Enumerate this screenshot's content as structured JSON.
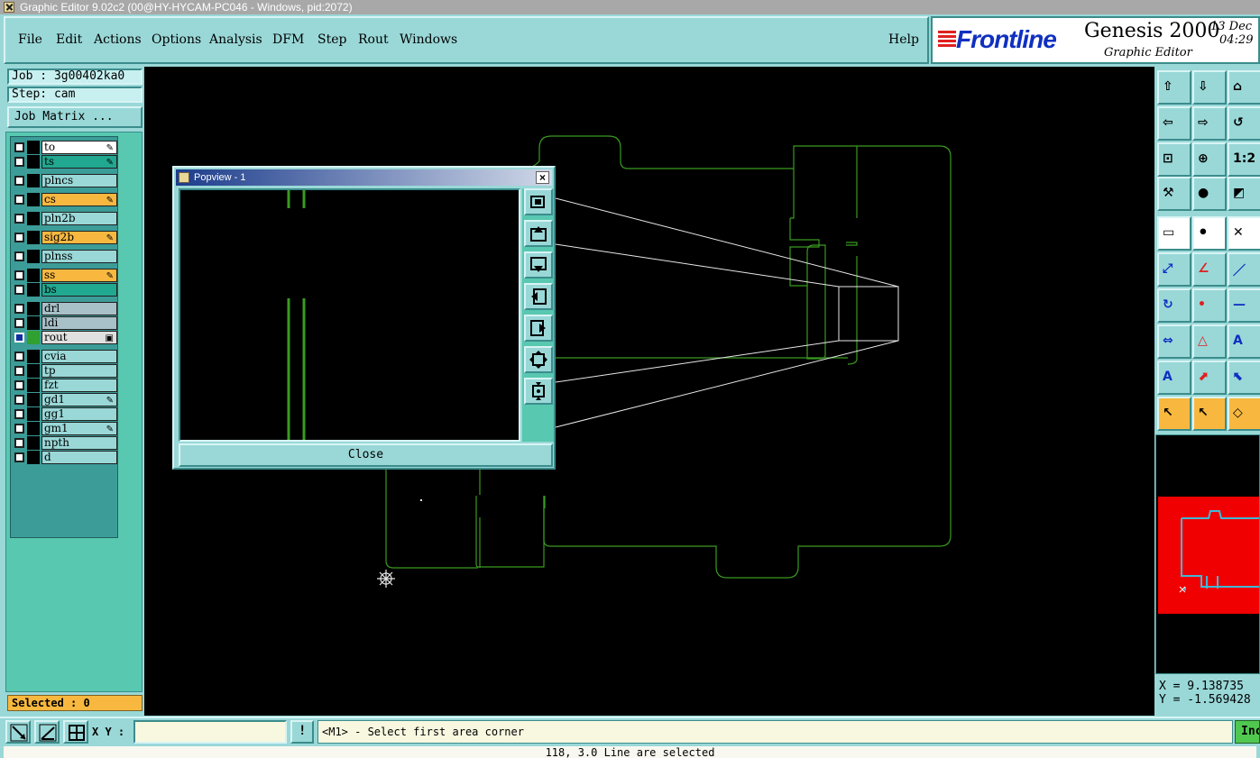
{
  "window": {
    "title": "Graphic Editor 9.02c2 (00@HY-HYCAM-PC046 - Windows, pid:2072)"
  },
  "menu": {
    "file": "File",
    "edit": "Edit",
    "actions": "Actions",
    "options": "Options",
    "analysis": "Analysis",
    "dfm": "DFM",
    "step": "Step",
    "rout": "Rout",
    "windows": "Windows",
    "help": "Help"
  },
  "logo": {
    "brand": "Frontline",
    "product": "Genesis 2000",
    "subtitle": "Graphic Editor",
    "date": "13 Dec",
    "time": "04:29"
  },
  "job": {
    "job_label": "Job : 3g00402ka0",
    "step_label": "Step: cam",
    "matrix_button": "Job Matrix ..."
  },
  "layers": [
    {
      "name": "to",
      "color": "#ffffff",
      "mark": "✎"
    },
    {
      "name": "ts",
      "color": "#20a890",
      "mark": "✎"
    },
    {
      "name": "plncs",
      "color": "#9ad8d8",
      "mark": ""
    },
    {
      "name": "cs",
      "color": "#f8b840",
      "mark": "✎"
    },
    {
      "name": "pln2b",
      "color": "#9ad8d8",
      "mark": ""
    },
    {
      "name": "sig2b",
      "color": "#f8b840",
      "mark": "✎"
    },
    {
      "name": "plnss",
      "color": "#9ad8d8",
      "mark": ""
    },
    {
      "name": "ss",
      "color": "#f8b840",
      "mark": "✎"
    },
    {
      "name": "bs",
      "color": "#20a890",
      "mark": ""
    },
    {
      "name": "drl",
      "color": "#a8c0c8",
      "mark": ""
    },
    {
      "name": "ldi",
      "color": "#a8c0c8",
      "mark": ""
    },
    {
      "name": "rout",
      "color": "#e0e0e0",
      "mark": "▣"
    },
    {
      "name": "cvia",
      "color": "#9ad8d8",
      "mark": ""
    },
    {
      "name": "tp",
      "color": "#9ad8d8",
      "mark": ""
    },
    {
      "name": "fzt",
      "color": "#9ad8d8",
      "mark": ""
    },
    {
      "name": "gd1",
      "color": "#9ad8d8",
      "mark": "✎"
    },
    {
      "name": "gg1",
      "color": "#9ad8d8",
      "mark": ""
    },
    {
      "name": "gm1",
      "color": "#9ad8d8",
      "mark": "✎"
    },
    {
      "name": "npth",
      "color": "#9ad8d8",
      "mark": ""
    },
    {
      "name": "d",
      "color": "#9ad8d8",
      "mark": ""
    }
  ],
  "selected": "Selected : 0",
  "popview": {
    "title": "Popview - 1",
    "close_x": "×",
    "close_button": "Close"
  },
  "coords": {
    "x": "X = 9.138735",
    "y": "Y = -1.569428"
  },
  "bottom": {
    "xy_label": "X Y :",
    "xy_value": "",
    "exclaim": "!",
    "prompt": "<M1> - Select first area corner",
    "indicator": "Inc"
  },
  "status": "118, 3.0 Line are selected",
  "icons": {
    "toolbar": [
      "zoom-home-icon",
      "pan-down-icon",
      "home-view-icon",
      "pan-left-icon",
      "pan-right-icon",
      "zoom-back-icon",
      "zoom-fit-icon",
      "zoom-center-icon",
      "scale-1-2-icon",
      "measure-tools-icon",
      "grid-icon",
      "snap-icon",
      "pad-icon",
      "clip-icon",
      "ruler-icon",
      "node-icon",
      "delete-node-icon",
      "connect-icon",
      "angle-icon",
      "line-icon",
      "rotate-icon",
      "point-icon",
      "segment-icon",
      "dimension-icon",
      "triangle-small-icon",
      "triangle-a-icon",
      "triangle-b-icon",
      "pointer-icon",
      "pointer-box-icon",
      "pointer-diamond-icon"
    ]
  }
}
